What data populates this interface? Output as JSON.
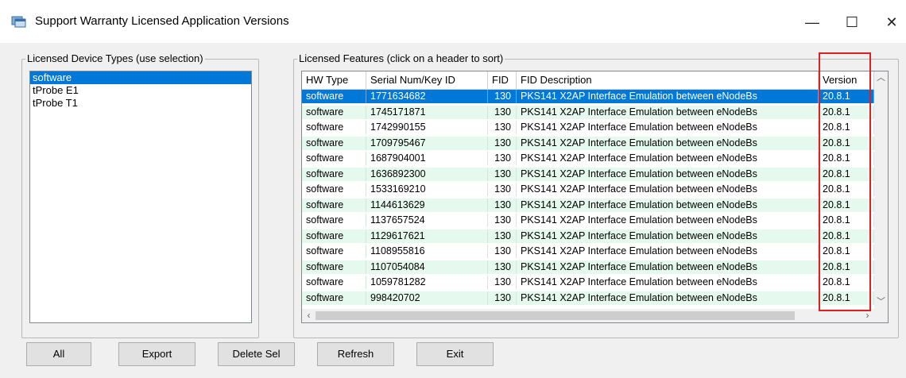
{
  "window": {
    "title": "Support Warranty Licensed Application Versions",
    "minimize_glyph": "—",
    "maximize_glyph": "☐",
    "close_glyph": "✕"
  },
  "device_group": {
    "label": "Licensed Device Types (use selection)",
    "items": [
      "software",
      "tProbe E1",
      "tProbe T1"
    ],
    "selected_index": 0
  },
  "features_group": {
    "label": "Licensed Features   (click on a header to sort)",
    "columns": [
      "HW Type",
      "Serial Num/Key ID",
      "FID",
      "FID Description",
      "Version"
    ],
    "rows": [
      [
        "software",
        "1771634682",
        "130",
        "PKS141 X2AP Interface Emulation between eNodeBs",
        "20.8.1"
      ],
      [
        "software",
        "1745171871",
        "130",
        "PKS141 X2AP Interface Emulation between eNodeBs",
        "20.8.1"
      ],
      [
        "software",
        "1742990155",
        "130",
        "PKS141 X2AP Interface Emulation between eNodeBs",
        "20.8.1"
      ],
      [
        "software",
        "1709795467",
        "130",
        "PKS141 X2AP Interface Emulation between eNodeBs",
        "20.8.1"
      ],
      [
        "software",
        "1687904001",
        "130",
        "PKS141 X2AP Interface Emulation between eNodeBs",
        "20.8.1"
      ],
      [
        "software",
        "1636892300",
        "130",
        "PKS141 X2AP Interface Emulation between eNodeBs",
        "20.8.1"
      ],
      [
        "software",
        "1533169210",
        "130",
        "PKS141 X2AP Interface Emulation between eNodeBs",
        "20.8.1"
      ],
      [
        "software",
        "1144613629",
        "130",
        "PKS141 X2AP Interface Emulation between eNodeBs",
        "20.8.1"
      ],
      [
        "software",
        "1137657524",
        "130",
        "PKS141 X2AP Interface Emulation between eNodeBs",
        "20.8.1"
      ],
      [
        "software",
        "1129617621",
        "130",
        "PKS141 X2AP Interface Emulation between eNodeBs",
        "20.8.1"
      ],
      [
        "software",
        "1108955816",
        "130",
        "PKS141 X2AP Interface Emulation between eNodeBs",
        "20.8.1"
      ],
      [
        "software",
        "1107054084",
        "130",
        "PKS141 X2AP Interface Emulation between eNodeBs",
        "20.8.1"
      ],
      [
        "software",
        "1059781282",
        "130",
        "PKS141 X2AP Interface Emulation between eNodeBs",
        "20.8.1"
      ],
      [
        "software",
        "998420702",
        "130",
        "PKS141 X2AP Interface Emulation between eNodeBs",
        "20.8.1"
      ]
    ],
    "selected_row": 0
  },
  "buttons": {
    "all": "All",
    "export": "Export",
    "delete_sel": "Delete Sel",
    "refresh": "Refresh",
    "exit": "Exit"
  },
  "icons": {
    "app": "application-window-icon",
    "scroll_up": "chevron-up-icon",
    "scroll_down": "chevron-down-icon",
    "scroll_left": "chevron-left-icon",
    "scroll_right": "chevron-right-icon"
  },
  "colors": {
    "selection": "#0078d7",
    "alt_row": "#e6f9ee",
    "annotation_box": "#e02020"
  }
}
